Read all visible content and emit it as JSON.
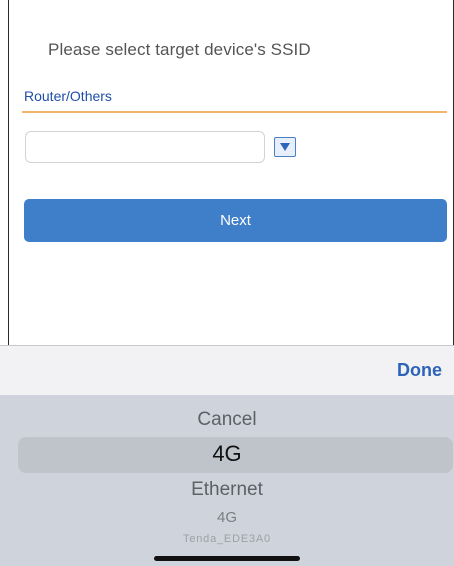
{
  "header": {
    "prompt": "Please select target device's SSID"
  },
  "section": {
    "label": "Router/Others"
  },
  "ssid_field": {
    "value": "",
    "placeholder": ""
  },
  "dropdown": {
    "icon": "triangle-down-icon"
  },
  "actions": {
    "next_label": "Next"
  },
  "picker": {
    "done_label": "Done",
    "items": [
      "Cancel",
      "4G",
      "Ethernet",
      "4G",
      "Tenda_EDE3A0"
    ],
    "selected_index": 1
  },
  "colors": {
    "accent": "#3f7ec8",
    "section_label": "#1f4fa8",
    "divider": "#f1b46a",
    "done": "#2d63b8"
  }
}
